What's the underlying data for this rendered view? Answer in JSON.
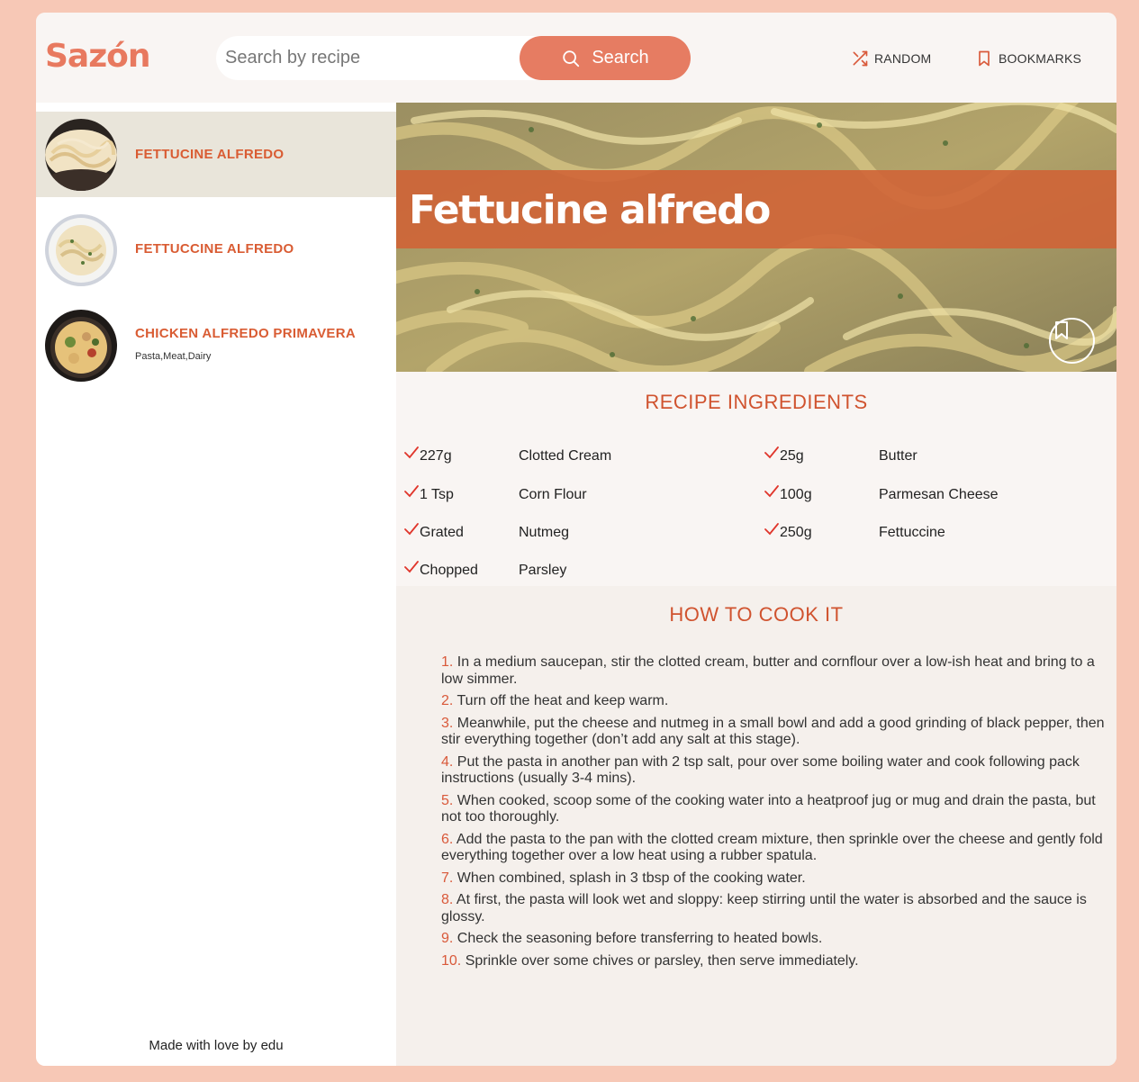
{
  "header": {
    "logo": "Sazón",
    "search_placeholder": "Search by recipe",
    "search_button": "Search",
    "random_label": "RANDOM",
    "bookmarks_label": "BOOKMARKS"
  },
  "sidebar": {
    "results": [
      {
        "title": "FETTUCINE ALFREDO",
        "tags": ""
      },
      {
        "title": "FETTUCCINE ALFREDO",
        "tags": ""
      },
      {
        "title": "CHICKEN ALFREDO PRIMAVERA",
        "tags": "Pasta,Meat,Dairy"
      }
    ],
    "footer": "Made with love by edu"
  },
  "recipe": {
    "title": "Fettucine alfredo",
    "ingredients_heading": "RECIPE INGREDIENTS",
    "ingredients": [
      {
        "qty": "227g",
        "name": "Clotted Cream"
      },
      {
        "qty": "25g",
        "name": "Butter"
      },
      {
        "qty": "1 Tsp",
        "name": "Corn Flour"
      },
      {
        "qty": "100g",
        "name": "Parmesan Cheese"
      },
      {
        "qty": "Grated",
        "name": "Nutmeg"
      },
      {
        "qty": "250g",
        "name": "Fettuccine"
      },
      {
        "qty": "Chopped",
        "name": "Parsley"
      }
    ],
    "cook_heading": "HOW TO COOK IT",
    "steps": [
      {
        "num": "1.",
        "text": "In a medium saucepan, stir the clotted cream, butter and cornflour over a low-ish heat and bring to a low simmer."
      },
      {
        "num": "2.",
        "text": "Turn off the heat and keep warm."
      },
      {
        "num": "3.",
        "text": "Meanwhile, put the cheese and nutmeg in a small bowl and add a good grinding of black pepper, then stir everything together (don’t add any salt at this stage)."
      },
      {
        "num": "4.",
        "text": "Put the pasta in another pan with 2 tsp salt, pour over some boiling water and cook following pack instructions (usually 3-4 mins)."
      },
      {
        "num": "5.",
        "text": "When cooked, scoop some of the cooking water into a heatproof jug or mug and drain the pasta, but not too thoroughly."
      },
      {
        "num": "6.",
        "text": "Add the pasta to the pan with the clotted cream mixture, then sprinkle over the cheese and gently fold everything together over a low heat using a rubber spatula."
      },
      {
        "num": "7.",
        "text": "When combined, splash in 3 tbsp of the cooking water."
      },
      {
        "num": "8.",
        "text": "At first, the pasta will look wet and sloppy: keep stirring until the water is absorbed and the sauce is glossy."
      },
      {
        "num": "9.",
        "text": "Check the seasoning before transferring to heated bowls."
      },
      {
        "num": "10.",
        "text": "Sprinkle over some chives or parsley, then serve immediately."
      }
    ]
  },
  "colors": {
    "accent": "#e67c62",
    "accent_dark": "#d0532f",
    "page_bg": "#f7c8b6"
  }
}
